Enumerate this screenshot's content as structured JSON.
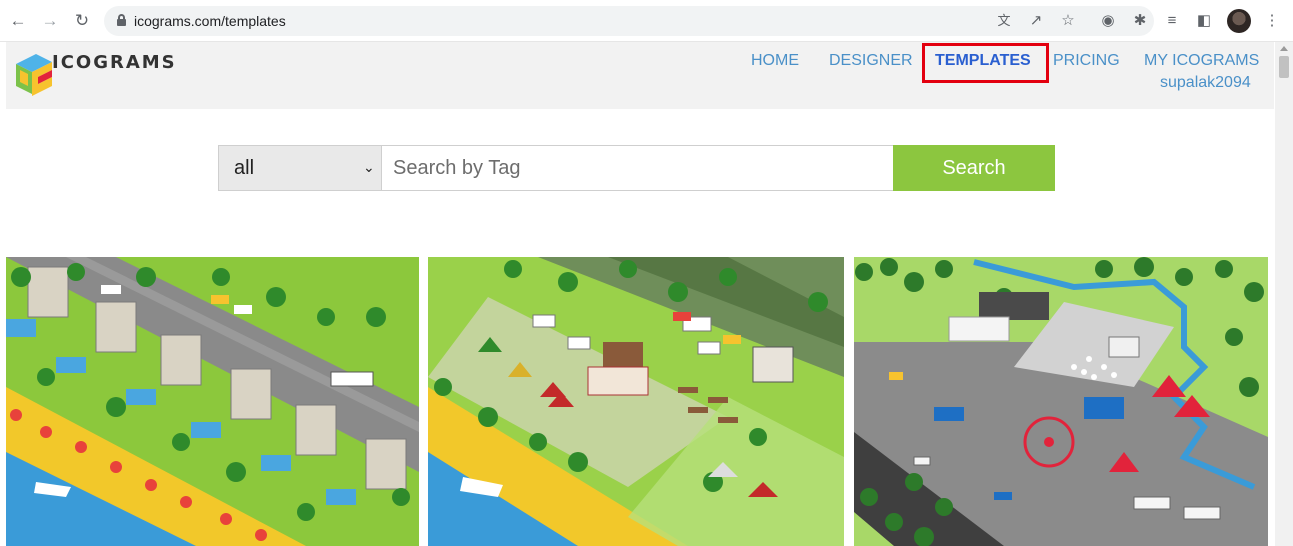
{
  "browser": {
    "url": "icograms.com/templates",
    "nav": {
      "back_icon": "arrow-left",
      "forward_icon": "arrow-right",
      "reload_icon": "reload"
    },
    "toolbar_icons": [
      "translate-icon",
      "share-icon",
      "star-icon",
      "camera-icon",
      "extensions-icon",
      "reading-list-icon",
      "side-panel-icon",
      "profile-avatar",
      "menu-icon"
    ]
  },
  "site": {
    "logo_text": "ICOGRAMS",
    "nav": {
      "home": "HOME",
      "designer": "DESIGNER",
      "templates": "TEMPLATES",
      "pricing": "PRICING",
      "my_icograms": "MY ICOGRAMS",
      "username": "supalak2094"
    },
    "active_nav": "templates",
    "highlight_color": "#e3000f",
    "link_color": "#4a90c8"
  },
  "search": {
    "category_value": "all",
    "placeholder": "Search by Tag",
    "button_label": "Search",
    "button_color": "#8cc63f"
  },
  "templates": [
    {
      "scene": "beach-villas"
    },
    {
      "scene": "campground"
    },
    {
      "scene": "amusement-park"
    }
  ]
}
